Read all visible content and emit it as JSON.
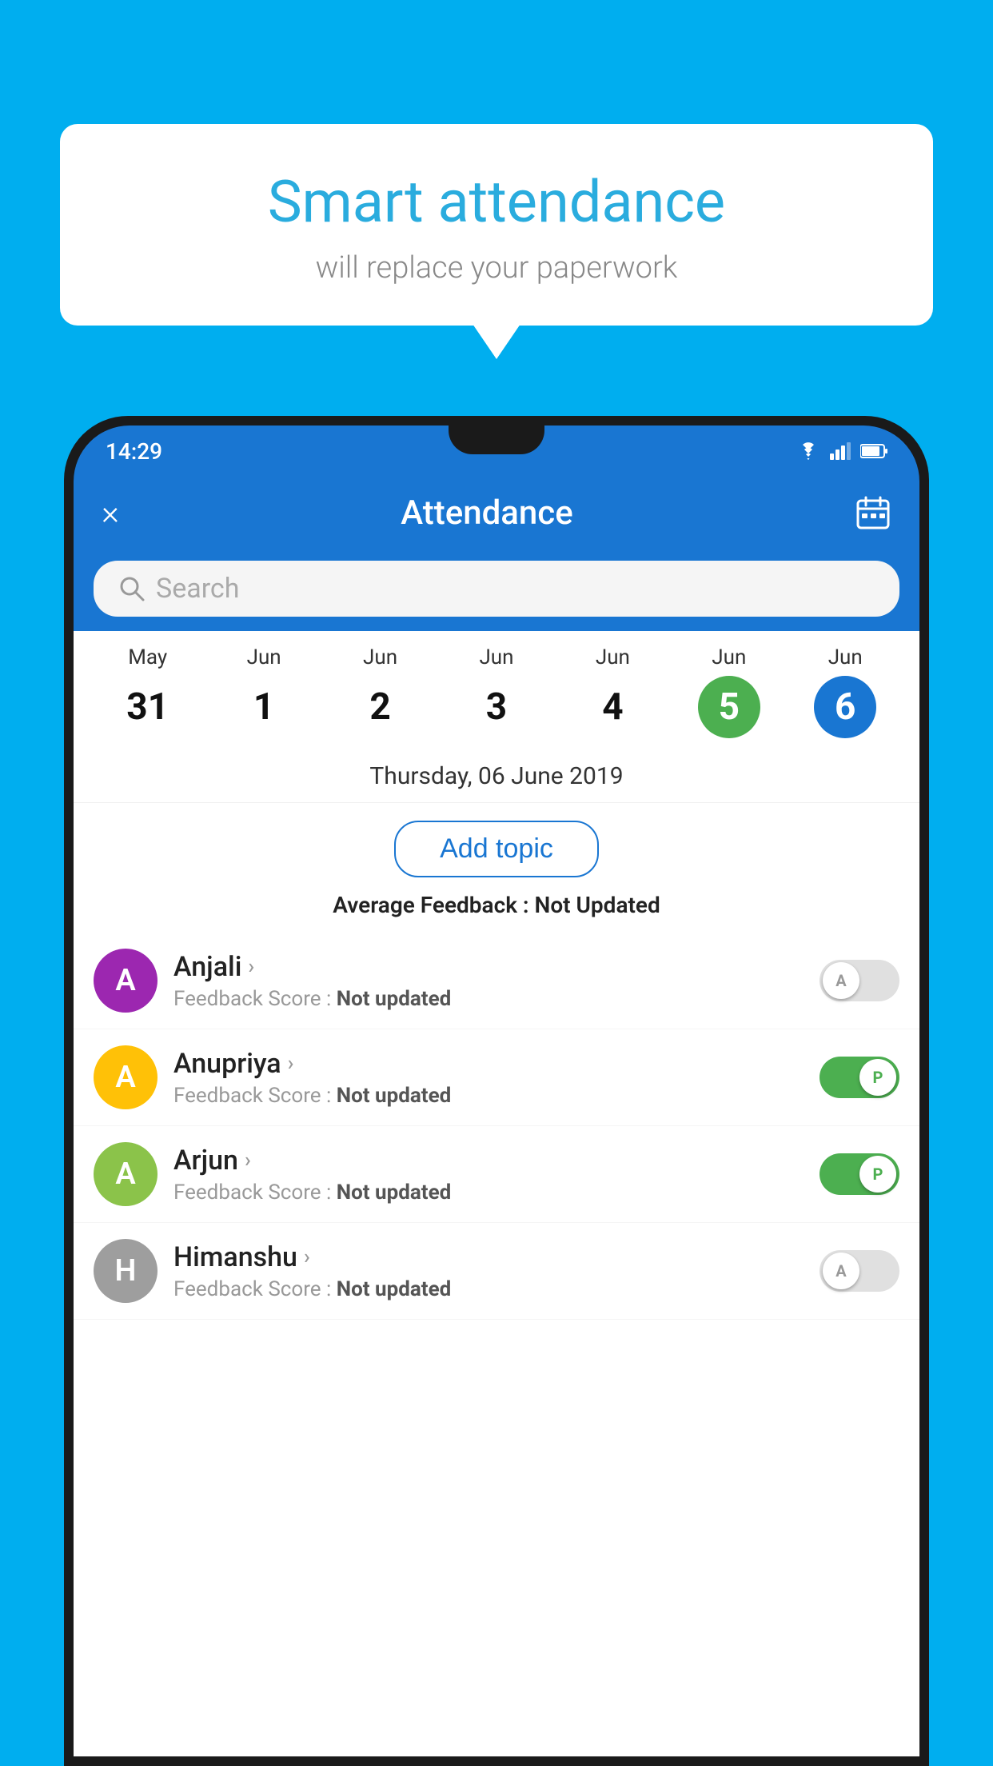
{
  "background_color": "#00AEEF",
  "speech_bubble": {
    "title": "Smart attendance",
    "subtitle": "will replace your paperwork"
  },
  "status_bar": {
    "time": "14:29",
    "icons": [
      "wifi",
      "signal",
      "battery"
    ]
  },
  "app_header": {
    "title": "Attendance",
    "close_label": "×",
    "calendar_icon": "calendar"
  },
  "search": {
    "placeholder": "Search"
  },
  "dates": [
    {
      "month": "May",
      "day": "31",
      "state": "normal"
    },
    {
      "month": "Jun",
      "day": "1",
      "state": "normal"
    },
    {
      "month": "Jun",
      "day": "2",
      "state": "normal"
    },
    {
      "month": "Jun",
      "day": "3",
      "state": "normal"
    },
    {
      "month": "Jun",
      "day": "4",
      "state": "normal"
    },
    {
      "month": "Jun",
      "day": "5",
      "state": "today"
    },
    {
      "month": "Jun",
      "day": "6",
      "state": "selected"
    }
  ],
  "selected_date_label": "Thursday, 06 June 2019",
  "add_topic_label": "Add topic",
  "avg_feedback": {
    "label": "Average Feedback :",
    "value": "Not Updated"
  },
  "students": [
    {
      "name": "Anjali",
      "avatar_letter": "A",
      "avatar_color": "#9C27B0",
      "feedback": "Not updated",
      "toggle_state": "off",
      "toggle_label": "A"
    },
    {
      "name": "Anupriya",
      "avatar_letter": "A",
      "avatar_color": "#FFC107",
      "feedback": "Not updated",
      "toggle_state": "on",
      "toggle_label": "P"
    },
    {
      "name": "Arjun",
      "avatar_letter": "A",
      "avatar_color": "#8BC34A",
      "feedback": "Not updated",
      "toggle_state": "on",
      "toggle_label": "P"
    },
    {
      "name": "Himanshu",
      "avatar_letter": "H",
      "avatar_color": "#9E9E9E",
      "feedback": "Not updated",
      "toggle_state": "off",
      "toggle_label": "A"
    }
  ],
  "feedback_score_label": "Feedback Score :"
}
